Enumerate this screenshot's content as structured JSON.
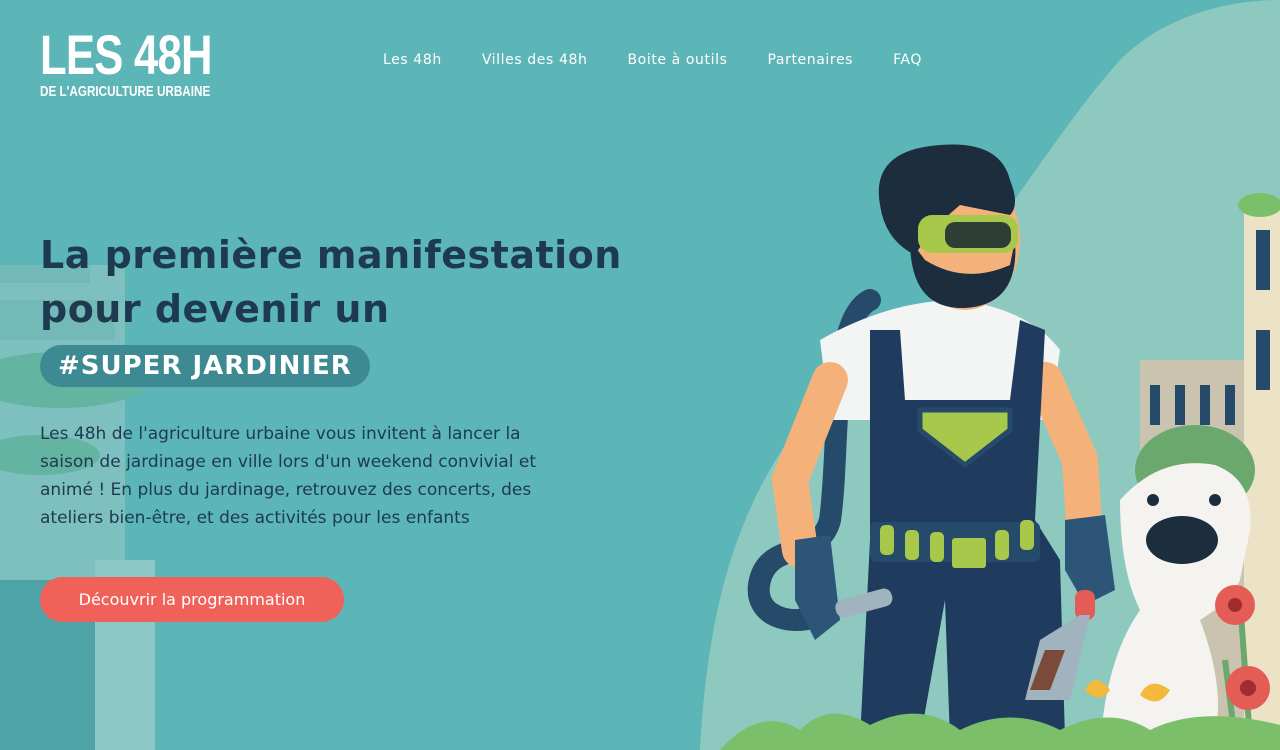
{
  "logo": {
    "title": "LES 48H",
    "subtitle": "DE L'AGRICULTURE URBAINE"
  },
  "nav": {
    "items": [
      {
        "label": "Les 48h"
      },
      {
        "label": "Villes des 48h"
      },
      {
        "label": "Boite à outils"
      },
      {
        "label": "Partenaires"
      },
      {
        "label": "FAQ"
      }
    ]
  },
  "hero": {
    "title_line1": "La première manifestation",
    "title_line2": "pour devenir un",
    "badge": "#SUPER JARDINIER",
    "description": "Les 48h de l'agriculture urbaine vous invitent à lancer la saison de jardinage en ville lors d'un weekend convivial et animé ! En plus du jardinage, retrouvez des concerts, des ateliers bien-être, et des activités pour les enfants",
    "cta_label": "Découvrir la programmation"
  },
  "colors": {
    "background": "#5cb5b7",
    "title": "#1d3a50",
    "badge": "#3d8a93",
    "cta": "#f0615a"
  }
}
